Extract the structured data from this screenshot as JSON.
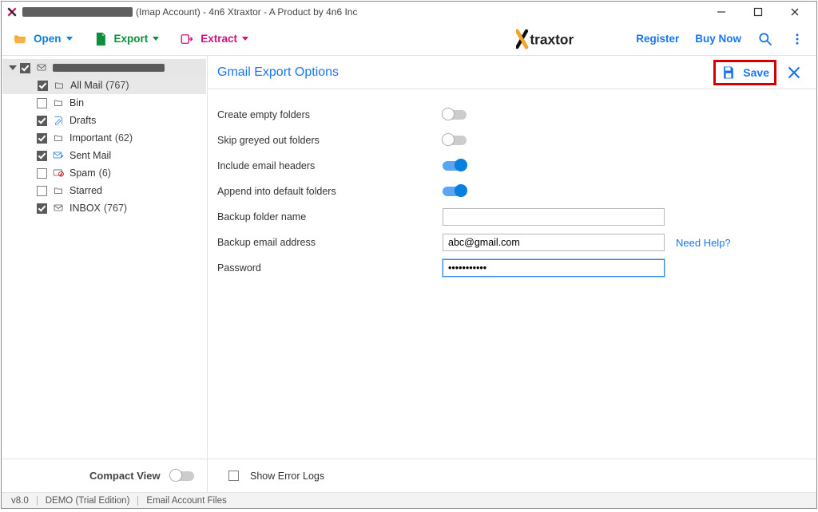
{
  "window": {
    "title_suffix": " (Imap Account) - 4n6 Xtraxtor - A Product by 4n6 Inc"
  },
  "toolbar": {
    "open": "Open",
    "export": "Export",
    "extract": "Extract",
    "register": "Register",
    "buy": "Buy Now"
  },
  "logo_text": "traxtor",
  "sidebar": {
    "items": [
      {
        "label": "All Mail",
        "count": "(767)",
        "checked": true,
        "icon": "folder",
        "selected": true
      },
      {
        "label": "Bin",
        "count": "",
        "checked": false,
        "icon": "folder"
      },
      {
        "label": "Drafts",
        "count": "",
        "checked": true,
        "icon": "draft"
      },
      {
        "label": "Important",
        "count": "(62)",
        "checked": true,
        "icon": "folder"
      },
      {
        "label": "Sent Mail",
        "count": "",
        "checked": true,
        "icon": "sent"
      },
      {
        "label": "Spam",
        "count": "(6)",
        "checked": false,
        "icon": "spam"
      },
      {
        "label": "Starred",
        "count": "",
        "checked": false,
        "icon": "folder"
      },
      {
        "label": "INBOX",
        "count": "(767)",
        "checked": true,
        "icon": "inbox"
      }
    ],
    "compact": "Compact View"
  },
  "panel": {
    "title": "Gmail Export Options",
    "save": "Save",
    "options": {
      "create_empty": "Create empty folders",
      "skip_greyed": "Skip greyed out folders",
      "include_headers": "Include email headers",
      "append_default": "Append into default folders",
      "backup_folder": "Backup folder name",
      "backup_email": "Backup email address",
      "password": "Password"
    },
    "values": {
      "backup_folder": "",
      "backup_email": "abc@gmail.com",
      "password": "•••••••••••"
    },
    "help": "Need Help?",
    "show_error": "Show Error Logs"
  },
  "footer": {
    "ver": "v8.0",
    "edition": "DEMO (Trial Edition)",
    "mode": "Email Account Files"
  }
}
